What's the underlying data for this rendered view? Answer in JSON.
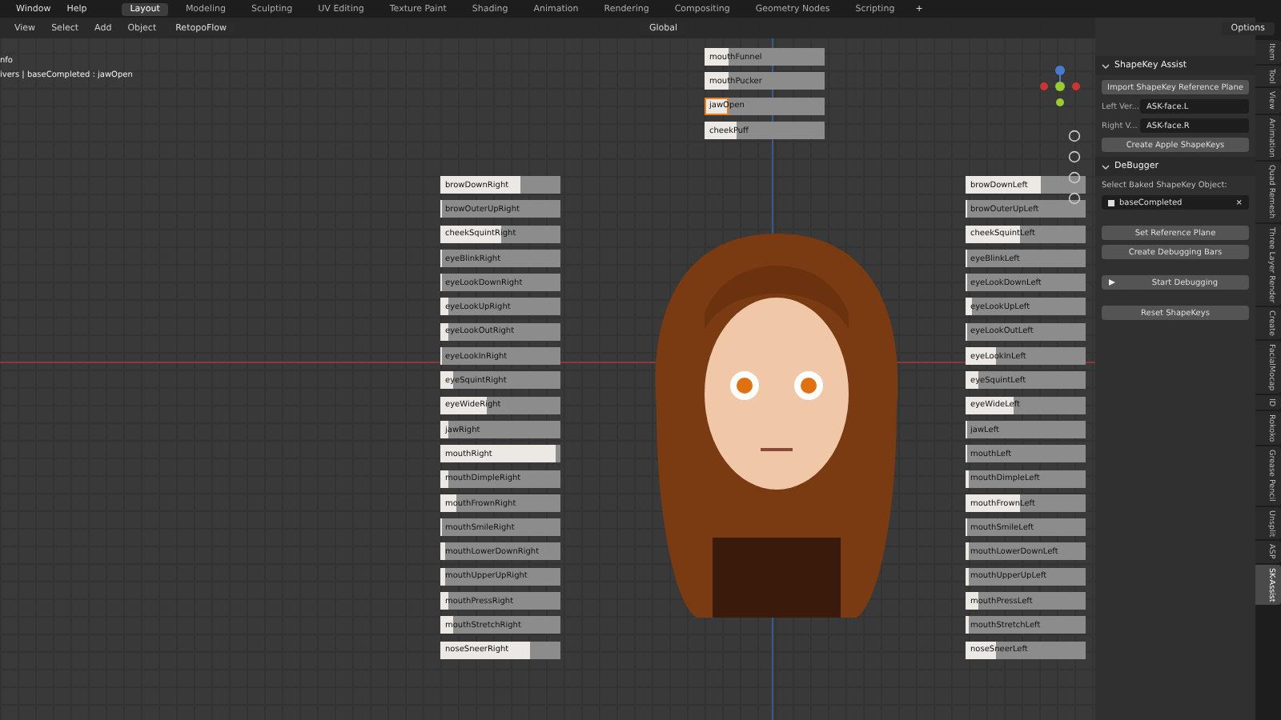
{
  "menubar": {
    "items": [
      "Window",
      "Help"
    ]
  },
  "workspaces": [
    {
      "label": "Layout",
      "selected": true
    },
    {
      "label": "Modeling",
      "selected": false
    },
    {
      "label": "Sculpting",
      "selected": false
    },
    {
      "label": "UV Editing",
      "selected": false
    },
    {
      "label": "Texture Paint",
      "selected": false
    },
    {
      "label": "Shading",
      "selected": false
    },
    {
      "label": "Animation",
      "selected": false
    },
    {
      "label": "Rendering",
      "selected": false
    },
    {
      "label": "Compositing",
      "selected": false
    },
    {
      "label": "Geometry Nodes",
      "selected": false
    },
    {
      "label": "Scripting",
      "selected": false
    }
  ],
  "add_workspace": "+",
  "header": {
    "menus": [
      "View",
      "Select",
      "Add",
      "Object"
    ],
    "addon": "RetopoFlow",
    "transform": "Global",
    "options": "Options"
  },
  "viewport_info": [
    "nfo",
    "ivers | baseCompleted : jawOpen"
  ],
  "center_bars": [
    {
      "label": "mouthFunnel",
      "level": 0.2,
      "selected": false
    },
    {
      "label": "mouthPucker",
      "level": 0.2,
      "selected": false
    },
    {
      "label": "jawOpen",
      "level": 0.2,
      "selected": true
    },
    {
      "label": "cheekPuff",
      "level": 0.27,
      "selected": false
    }
  ],
  "left_bars": [
    {
      "label": "browDownRight",
      "level": 0.67
    },
    {
      "label": "browOuterUpRight",
      "level": 0
    },
    {
      "label": "cheekSquintRight",
      "level": 0.5
    },
    {
      "label": "eyeBlinkRight",
      "level": 0
    },
    {
      "label": "eyeLookDownRight",
      "level": 0
    },
    {
      "label": "eyeLookUpRight",
      "level": 0.06
    },
    {
      "label": "eyeLookOutRight",
      "level": 0.07
    },
    {
      "label": "eyeLookInRight",
      "level": 0
    },
    {
      "label": "eyeSquintRight",
      "level": 0.1
    },
    {
      "label": "eyeWideRight",
      "level": 0.38
    },
    {
      "label": "jawRight",
      "level": 0.07
    },
    {
      "label": "mouthRight",
      "level": 0.96
    },
    {
      "label": "mouthDimpleRight",
      "level": 0.07
    },
    {
      "label": "mouthFrownRight",
      "level": 0.13
    },
    {
      "label": "mouthSmileRight",
      "level": 0
    },
    {
      "label": "mouthLowerDownRight",
      "level": 0.04
    },
    {
      "label": "mouthUpperUpRight",
      "level": 0.04
    },
    {
      "label": "mouthPressRight",
      "level": 0.07
    },
    {
      "label": "mouthStretchRight",
      "level": 0.1
    },
    {
      "label": "noseSneerRight",
      "level": 0.75
    }
  ],
  "right_bars": [
    {
      "label": "browDownLeft",
      "level": 0.63
    },
    {
      "label": "browOuterUpLeft",
      "level": 0
    },
    {
      "label": "cheekSquintLeft",
      "level": 0.45
    },
    {
      "label": "eyeBlinkLeft",
      "level": 0
    },
    {
      "label": "eyeLookDownLeft",
      "level": 0
    },
    {
      "label": "eyeLookUpLeft",
      "level": 0.05
    },
    {
      "label": "eyeLookOutLeft",
      "level": 0
    },
    {
      "label": "eyeLookInLeft",
      "level": 0.25
    },
    {
      "label": "eyeSquintLeft",
      "level": 0.1
    },
    {
      "label": "eyeWideLeft",
      "level": 0.4
    },
    {
      "label": "jawLeft",
      "level": 0
    },
    {
      "label": "mouthLeft",
      "level": 0
    },
    {
      "label": "mouthDimpleLeft",
      "level": 0.02
    },
    {
      "label": "mouthFrownLeft",
      "level": 0.45
    },
    {
      "label": "mouthSmileLeft",
      "level": 0
    },
    {
      "label": "mouthLowerDownLeft",
      "level": 0.02
    },
    {
      "label": "mouthUpperUpLeft",
      "level": 0.02
    },
    {
      "label": "mouthPressLeft",
      "level": 0.1
    },
    {
      "label": "mouthStretchLeft",
      "level": 0.03
    },
    {
      "label": "noseSneerLeft",
      "level": 0.25
    }
  ],
  "panels": [
    {
      "title": "ShapeKey Assist",
      "expanded": true,
      "items": [
        {
          "kind": "button",
          "label": "Import ShapeKey Reference Plane"
        },
        {
          "kind": "field",
          "label": "Left Ver...",
          "value": "ASK-face.L"
        },
        {
          "kind": "field",
          "label": "Right V...",
          "value": "ASK-face.R"
        },
        {
          "kind": "button",
          "label": "Create Apple ShapeKeys"
        }
      ]
    },
    {
      "title": "DeBugger",
      "expanded": true,
      "items": [
        {
          "kind": "text",
          "label": "Select Baked ShapeKey Object:"
        },
        {
          "kind": "object",
          "value": "baseCompleted",
          "clear": "×"
        },
        {
          "kind": "spacer"
        },
        {
          "kind": "button",
          "label": "Set Reference Plane"
        },
        {
          "kind": "button",
          "label": "Create Debugging Bars"
        },
        {
          "kind": "spacer"
        },
        {
          "kind": "play",
          "label": "Start Debugging"
        },
        {
          "kind": "spacer"
        },
        {
          "kind": "button",
          "label": "Reset ShapeKeys"
        }
      ]
    }
  ],
  "sidebar_tabs": [
    {
      "label": "Item",
      "selected": false
    },
    {
      "label": "Tool",
      "selected": false
    },
    {
      "label": "View",
      "selected": false
    },
    {
      "label": "Animation",
      "selected": false
    },
    {
      "label": "Quad Remesh",
      "selected": false
    },
    {
      "label": "Three Layer Render",
      "selected": false
    },
    {
      "label": "Create",
      "selected": false
    },
    {
      "label": "FacialMocap",
      "selected": false
    },
    {
      "label": "ID",
      "selected": false
    },
    {
      "label": "Rokoko",
      "selected": false
    },
    {
      "label": "Grease Pencil",
      "selected": false
    },
    {
      "label": "Unsplit",
      "selected": false
    },
    {
      "label": "ASP",
      "selected": false
    },
    {
      "label": "SK-Assist",
      "selected": true
    }
  ]
}
